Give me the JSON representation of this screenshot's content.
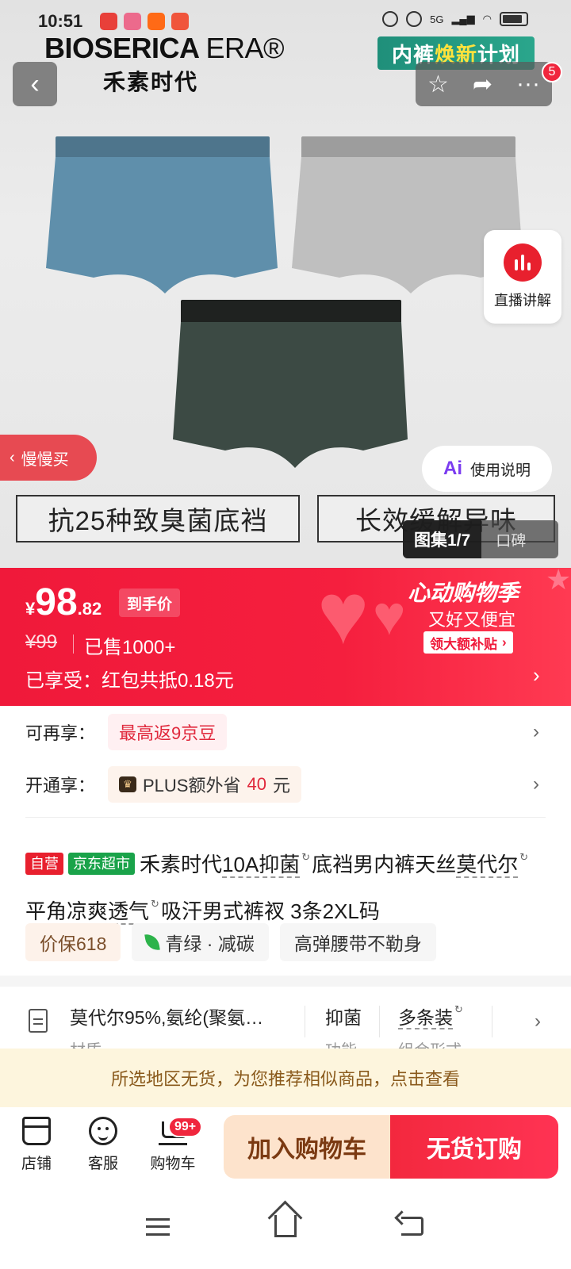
{
  "status_bar": {
    "time": "10:51",
    "network": "5G"
  },
  "brand": {
    "name_en": "BIOSERICA",
    "name_era": "ERA®",
    "name_cn": "禾素时代"
  },
  "promo_banner": {
    "text_a": "内裤",
    "text_highlight": "焕新",
    "text_b": "计划"
  },
  "top_bar": {
    "back_label": "‹",
    "more_badge": "5"
  },
  "hero": {
    "live_label": "直播讲解",
    "slow_buy_label": "慢慢买",
    "usage_label": "使用说明",
    "ai_label": "Ai",
    "feature_1": "抗25种致臭菌底裆",
    "feature_2": "长效缓解异味",
    "gallery_current": "图集1/7",
    "gallery_other": "口碑",
    "colors": [
      "#5f8fab",
      "#bfbfbf",
      "#3c4a44"
    ]
  },
  "price": {
    "currency": "¥",
    "integer": "98",
    "decimal": ".82",
    "tag": "到手价",
    "original": "¥99",
    "sold": "已售1000+",
    "enjoyed": "已享受：红包共抵0.18元",
    "event_title": "心动购物季",
    "event_sub": "又好又便宜",
    "event_button": "领大额补贴"
  },
  "benefits": [
    {
      "label": "可再享：",
      "chip": "最高返9京豆"
    },
    {
      "label": "开通享：",
      "chip_prefix": "PLUS额外省",
      "chip_num": "40",
      "chip_suffix": "元"
    }
  ],
  "title": {
    "tag_self": "自营",
    "tag_jd": "京东超市",
    "part_1": "禾素时代",
    "kw_1": "10A抑菌",
    "part_2": "底裆男内裤天丝",
    "kw_2": "莫代尔",
    "part_3": "平角",
    "kw_3": "凉爽透气",
    "part_4": "吸汗男式裤衩 3条2XL码"
  },
  "chips": [
    "价保618",
    "青绿 · 减碳",
    "高弹腰带不勒身"
  ],
  "spec": {
    "material": "莫代尔95%,氨纶(聚氨…",
    "material_sub": "材质",
    "feature": "抑菌",
    "feature_sub": "功能",
    "pack": "多条装",
    "pack_sub": "组合形式"
  },
  "notice": "所选地区无货，为您推荐相似商品，点击查看",
  "action_bar": {
    "store": "店铺",
    "service": "客服",
    "cart": "购物车",
    "cart_badge": "99+",
    "add_to_cart": "加入购物车",
    "out_of_stock_order": "无货订购"
  },
  "theme": {
    "accent_red": "#f0193a",
    "notice_bg": "#fdf5dd"
  }
}
